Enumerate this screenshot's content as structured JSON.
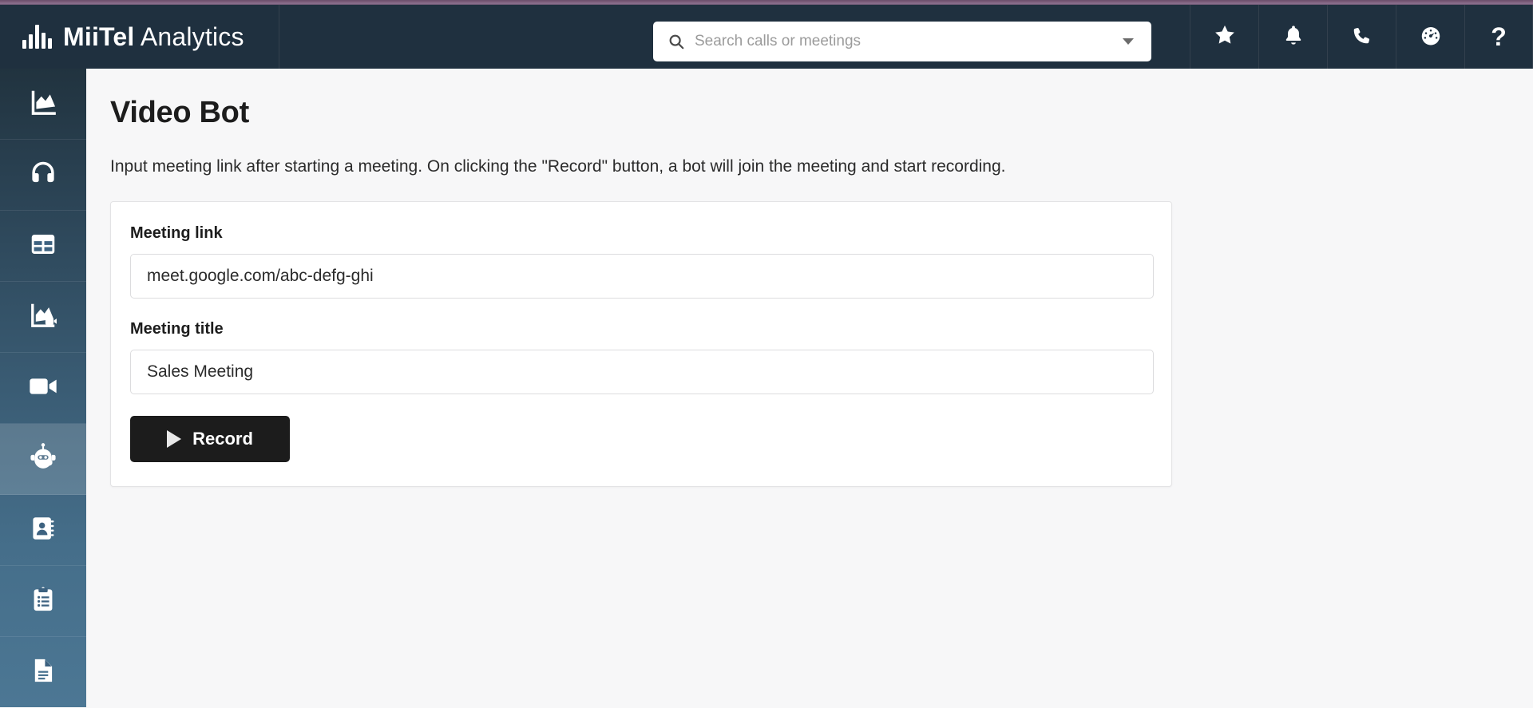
{
  "brand": {
    "name_bold": "MiiTel",
    "name_light": "Analytics",
    "logo_icon": "waveform-logo-icon"
  },
  "search": {
    "placeholder": "Search calls or meetings",
    "value": "",
    "icon": "search-icon",
    "dropdown_icon": "chevron-down-icon"
  },
  "header_actions": [
    {
      "name": "favorites",
      "icon": "star-icon"
    },
    {
      "name": "notifications",
      "icon": "bell-icon"
    },
    {
      "name": "calls",
      "icon": "phone-icon"
    },
    {
      "name": "dashboard",
      "icon": "gauge-icon"
    },
    {
      "name": "help",
      "icon": "question-mark-icon",
      "glyph": "?"
    }
  ],
  "sidebar": {
    "items": [
      {
        "name": "analytics",
        "icon": "area-chart-icon",
        "active": false
      },
      {
        "name": "calls",
        "icon": "headphones-icon",
        "active": false
      },
      {
        "name": "tables",
        "icon": "table-grid-icon",
        "active": false
      },
      {
        "name": "video-analytics",
        "icon": "chart-video-icon",
        "active": false
      },
      {
        "name": "meetings",
        "icon": "video-camera-icon",
        "active": false
      },
      {
        "name": "video-bot",
        "icon": "robot-icon",
        "active": true
      },
      {
        "name": "contacts",
        "icon": "address-book-icon",
        "active": false
      },
      {
        "name": "reports",
        "icon": "clipboard-list-icon",
        "active": false
      },
      {
        "name": "documents",
        "icon": "document-icon",
        "active": false
      }
    ]
  },
  "page": {
    "title": "Video Bot",
    "description": "Input meeting link after starting a meeting. On clicking the \"Record\" button, a bot will join the meeting and start recording."
  },
  "form": {
    "meeting_link_label": "Meeting link",
    "meeting_link_value": "meet.google.com/abc-defg-ghi",
    "meeting_link_placeholder": "",
    "meeting_title_label": "Meeting title",
    "meeting_title_value": "Sales Meeting",
    "meeting_title_placeholder": "",
    "record_button_label": "Record",
    "record_button_icon": "play-icon"
  },
  "colors": {
    "accent_top_bar": "#7d5f7d",
    "header_bg": "#1f303f",
    "sidebar_top": "#21333f",
    "sidebar_bottom": "#4c7794",
    "sidebar_active": "#5d7a91",
    "page_bg": "#f7f7f8",
    "record_button_bg": "#1c1c1c"
  }
}
